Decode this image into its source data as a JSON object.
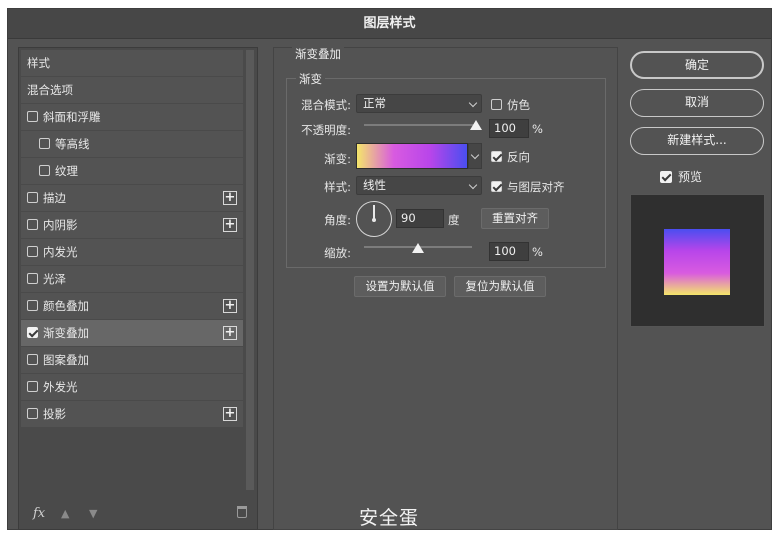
{
  "window": {
    "title": "图层样式"
  },
  "left": {
    "items": [
      {
        "label": "样式",
        "checkbox": false,
        "checked": false,
        "plus": false,
        "indent": false
      },
      {
        "label": "混合选项",
        "checkbox": false,
        "checked": false,
        "plus": false,
        "indent": false
      },
      {
        "label": "斜面和浮雕",
        "checkbox": true,
        "checked": false,
        "plus": false,
        "indent": false
      },
      {
        "label": "等高线",
        "checkbox": true,
        "checked": false,
        "plus": false,
        "indent": true
      },
      {
        "label": "纹理",
        "checkbox": true,
        "checked": false,
        "plus": false,
        "indent": true
      },
      {
        "label": "描边",
        "checkbox": true,
        "checked": false,
        "plus": true,
        "indent": false
      },
      {
        "label": "内阴影",
        "checkbox": true,
        "checked": false,
        "plus": true,
        "indent": false
      },
      {
        "label": "内发光",
        "checkbox": true,
        "checked": false,
        "plus": false,
        "indent": false
      },
      {
        "label": "光泽",
        "checkbox": true,
        "checked": false,
        "plus": false,
        "indent": false
      },
      {
        "label": "颜色叠加",
        "checkbox": true,
        "checked": false,
        "plus": true,
        "indent": false
      },
      {
        "label": "渐变叠加",
        "checkbox": true,
        "checked": true,
        "plus": true,
        "indent": false,
        "selected": true
      },
      {
        "label": "图案叠加",
        "checkbox": true,
        "checked": false,
        "plus": false,
        "indent": false
      },
      {
        "label": "外发光",
        "checkbox": true,
        "checked": false,
        "plus": false,
        "indent": false
      },
      {
        "label": "投影",
        "checkbox": true,
        "checked": false,
        "plus": true,
        "indent": false
      }
    ],
    "footer": {
      "fx_label": "fx",
      "up_icon": "arrow-up-icon",
      "down_icon": "arrow-down-icon",
      "trash_icon": "trash-icon"
    }
  },
  "mid": {
    "section_title": "渐变叠加",
    "group_title": "渐变",
    "blend_mode_label": "混合模式:",
    "blend_mode_value": "正常",
    "dither_label": "仿色",
    "opacity_label": "不透明度:",
    "opacity_value": "100",
    "opacity_unit": "%",
    "opacity_fraction": 1.0,
    "gradient_label": "渐变:",
    "gradient_colors": [
      "#f4e66a",
      "#d85be0",
      "#b845ea",
      "#4a4ef0"
    ],
    "reverse_label": "反向",
    "reverse_checked": true,
    "style_label": "样式:",
    "style_value": "线性",
    "align_label": "与图层对齐",
    "align_checked": true,
    "angle_label": "角度:",
    "angle_value": "90",
    "angle_unit": "度",
    "reset_align_label": "重置对齐",
    "scale_label": "缩放:",
    "scale_value": "100",
    "scale_unit": "%",
    "scale_fraction": 0.5,
    "set_default_label": "设置为默认值",
    "reset_default_label": "复位为默认值"
  },
  "right": {
    "ok_label": "确定",
    "cancel_label": "取消",
    "new_style_label": "新建样式...",
    "preview_label": "预览",
    "preview_checked": true
  },
  "watermark": "安全蛋"
}
